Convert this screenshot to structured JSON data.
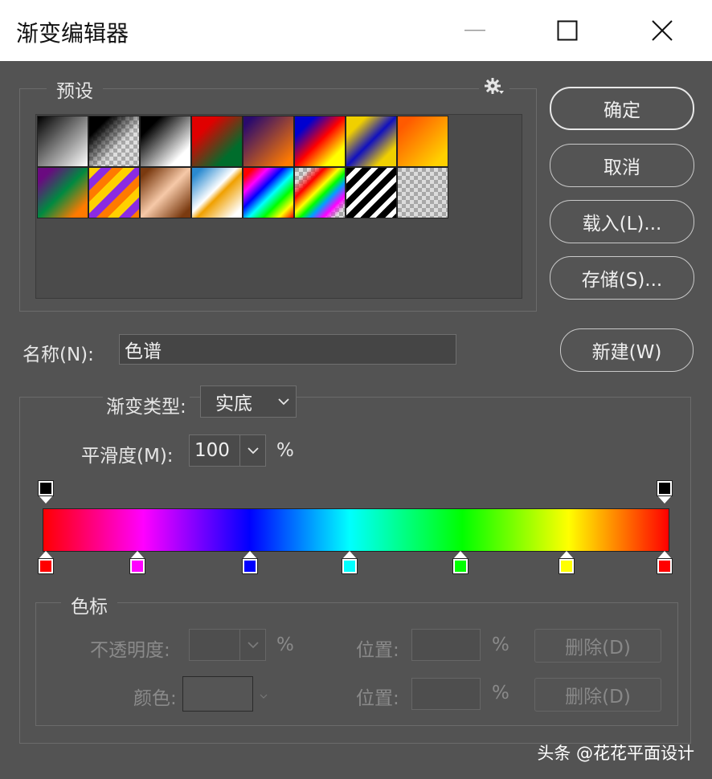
{
  "window": {
    "title": "渐变编辑器",
    "minimize_glyph": "—",
    "maximize_glyph": "☐",
    "close_glyph": "✕"
  },
  "presets": {
    "legend": "预设",
    "gear_glyph": "⚙"
  },
  "buttons": {
    "ok": "确定",
    "cancel": "取消",
    "load": "载入(L)...",
    "save": "存储(S)...",
    "new": "新建(W)"
  },
  "name": {
    "label": "名称(N):",
    "value": "色谱"
  },
  "gradient_type": {
    "label": "渐变类型:",
    "value": "实底"
  },
  "smoothness": {
    "label": "平滑度(M):",
    "value": "100",
    "unit": "%"
  },
  "gradient_colors": [
    "#ff0000",
    "#ff00ff",
    "#0000ff",
    "#00ffff",
    "#00ff00",
    "#ffff00",
    "#ff0000"
  ],
  "color_stops_panel": {
    "legend": "色标",
    "opacity_label": "不透明度:",
    "opacity_unit": "%",
    "location_label": "位置:",
    "location_unit": "%",
    "delete_label": "删除(D)",
    "color_label": "颜色:",
    "location_label_2": "位置:",
    "location_unit_2": "%",
    "delete_label_2": "删除(D)"
  },
  "watermark": "头条 @花花平面设计"
}
